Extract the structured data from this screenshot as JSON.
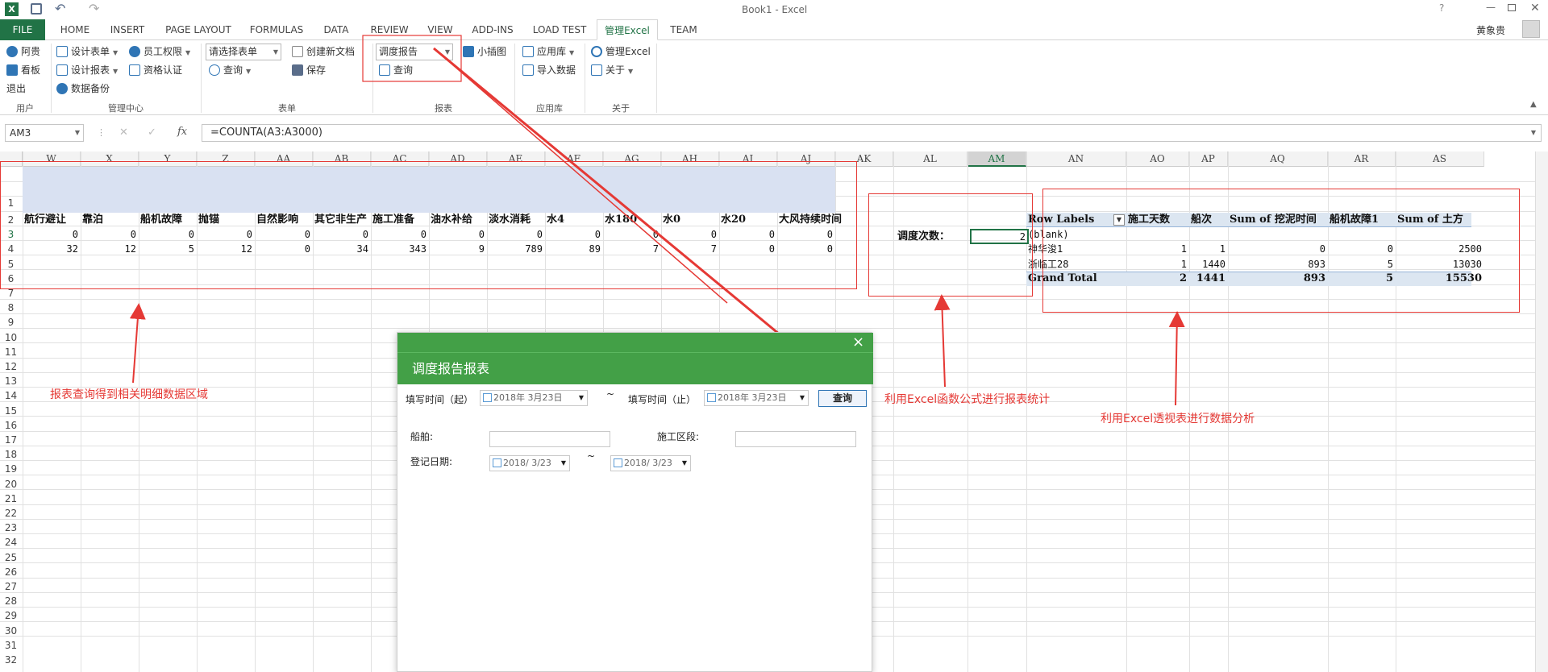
{
  "window": {
    "title": "Book1 - Excel",
    "user": "黄象贵"
  },
  "qat": {
    "undo": "↶",
    "redo": "↷"
  },
  "tabs": [
    "FILE",
    "HOME",
    "INSERT",
    "PAGE LAYOUT",
    "FORMULAS",
    "DATA",
    "REVIEW",
    "VIEW",
    "ADD-INS",
    "LOAD TEST",
    "管理Excel",
    "TEAM"
  ],
  "ribbon": {
    "user": {
      "login": "阿贵",
      "board": "看板",
      "logout": "退出",
      "label": "用户"
    },
    "mgmt": {
      "design_form": "设计表单",
      "staff_perm": "员工权限",
      "design_report": "设计报表",
      "qualification": "资格认证",
      "backup": "数据备份",
      "label": "管理中心"
    },
    "form": {
      "select_placeholder": "请选择表单",
      "query": "查询",
      "new_doc": "创建新文档",
      "save": "保存",
      "label": "表单"
    },
    "report": {
      "select_value": "调度报告",
      "query": "查询",
      "small_chart": "小插图",
      "label": "报表"
    },
    "applib": {
      "app_lib": "应用库",
      "import": "导入数据",
      "label": "应用库"
    },
    "about": {
      "manage": "管理Excel",
      "about": "关于",
      "label": "关于"
    }
  },
  "formula": {
    "name_box": "AM3",
    "formula": "=COUNTA(A3:A3000)",
    "fx": "fx",
    "cancel": "✕",
    "enter": "✓"
  },
  "columns": [
    {
      "name": "W"
    },
    {
      "name": "X"
    },
    {
      "name": "Y"
    },
    {
      "name": "Z"
    },
    {
      "name": "AA"
    },
    {
      "name": "AB"
    },
    {
      "name": "AC"
    },
    {
      "name": "AD"
    },
    {
      "name": "AE"
    },
    {
      "name": "AF"
    },
    {
      "name": "AG"
    },
    {
      "name": "AH"
    },
    {
      "name": "AI"
    },
    {
      "name": "AJ"
    },
    {
      "name": "AK"
    },
    {
      "name": "AL"
    },
    {
      "name": "AM"
    },
    {
      "name": "AN"
    },
    {
      "name": "AO"
    },
    {
      "name": "AP"
    },
    {
      "name": "AQ"
    },
    {
      "name": "AR"
    },
    {
      "name": "AS"
    }
  ],
  "rows": [
    "1",
    "2",
    "3",
    "4",
    "5",
    "6",
    "7",
    "8",
    "9",
    "10",
    "11",
    "12",
    "13",
    "14",
    "15",
    "16",
    "17",
    "18",
    "19",
    "20",
    "21",
    "22",
    "23",
    "24",
    "25",
    "26",
    "27",
    "28",
    "29",
    "30",
    "31",
    "32"
  ],
  "detail_table": {
    "headers": [
      "航行避让",
      "靠泊",
      "船机故障",
      "抛锚",
      "自然影响",
      "其它非生产",
      "施工准备",
      "油水补给",
      "淡水消耗",
      "水4",
      "水180",
      "水0",
      "水20",
      "大风持续时间"
    ],
    "row3": [
      "0",
      "0",
      "0",
      "0",
      "0",
      "0",
      "0",
      "0",
      "0",
      "0",
      "0",
      "0",
      "0",
      "0"
    ],
    "row4": [
      "32",
      "12",
      "5",
      "12",
      "0",
      "34",
      "343",
      "9",
      "789",
      "89",
      "7",
      "7",
      "0",
      "0"
    ]
  },
  "stat": {
    "label": "调度次数：",
    "value": "2"
  },
  "pivot": {
    "headers": [
      "Row Labels",
      "施工天数",
      "船次",
      "Sum of 挖泥时间",
      "船机故障1",
      "Sum of 土方"
    ],
    "rows": [
      [
        "(blank)",
        "",
        "",
        "",
        "",
        ""
      ],
      [
        "神华浚1",
        "1",
        "1",
        "0",
        "0",
        "2500"
      ],
      [
        "浙临工28",
        "1",
        "1440",
        "893",
        "5",
        "13030"
      ]
    ],
    "total": [
      "Grand Total",
      "2",
      "1441",
      "893",
      "5",
      "15530"
    ]
  },
  "annotations": {
    "detail": "报表查询得到相关明细数据区域",
    "formula": "利用Excel函数公式进行报表统计",
    "pivot": "利用Excel透视表进行数据分析"
  },
  "dialog": {
    "title": "调度报告报表",
    "close": "×",
    "fill_start_label": "填写时间（起）",
    "fill_start_value": "2018年 3月23日",
    "tilde": "~",
    "fill_end_label": "填写时间（止）",
    "fill_end_value": "2018年 3月23日",
    "query_button": "查询",
    "ship_label": "船舶:",
    "section_label": "施工区段:",
    "reg_date_label": "登记日期:",
    "reg_start_value": "2018/ 3/23",
    "reg_end_value": "2018/ 3/23"
  },
  "colors": {
    "excel_green": "#217346",
    "dialog_green": "#43a047",
    "annotation_red": "#e53935",
    "band_blue": "#d9e1f2"
  }
}
